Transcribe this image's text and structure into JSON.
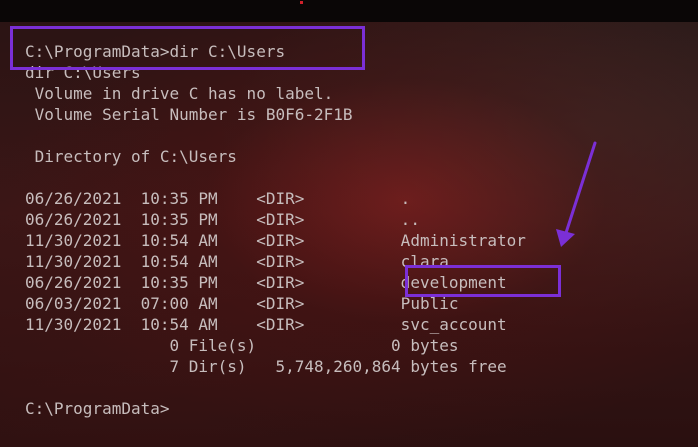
{
  "terminal": {
    "lines": [
      "C:\\ProgramData>dir C:\\Users",
      "dir C:\\Users",
      " Volume in drive C has no label.",
      " Volume Serial Number is B0F6-2F1B",
      "",
      " Directory of C:\\Users",
      "",
      "06/26/2021  10:35 PM    <DIR>          .",
      "06/26/2021  10:35 PM    <DIR>          ..",
      "11/30/2021  10:54 AM    <DIR>          Administrator",
      "11/30/2021  10:54 AM    <DIR>          clara",
      "06/26/2021  10:35 PM    <DIR>          development",
      "06/03/2021  07:00 AM    <DIR>          Public",
      "11/30/2021  10:54 AM    <DIR>          svc_account",
      "               0 File(s)              0 bytes",
      "               7 Dir(s)   5,748,260,864 bytes free",
      "",
      "C:\\ProgramData>"
    ]
  },
  "annotations": {
    "highlight_color": "#7b2fd6",
    "arrow_color": "#7b2fd6"
  }
}
